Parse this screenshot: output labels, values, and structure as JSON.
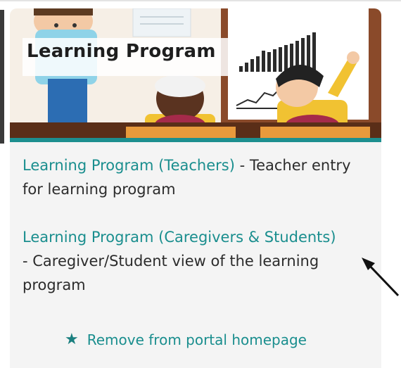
{
  "banner": {
    "title": "Learning Program"
  },
  "links": [
    {
      "label": "Learning Program (Teachers)",
      "description": " - Teacher entry for learning program"
    },
    {
      "label": "Learning Program (Caregivers & Students)",
      "description": "- Caregiver/Student view of the learning program"
    }
  ],
  "actions": {
    "remove_label": "Remove from portal homepage",
    "remove_icon": "star-icon"
  },
  "colors": {
    "link": "#1a8e8e",
    "banner_strip": "#1d8f8f",
    "card_bg": "#f4f4f4"
  }
}
